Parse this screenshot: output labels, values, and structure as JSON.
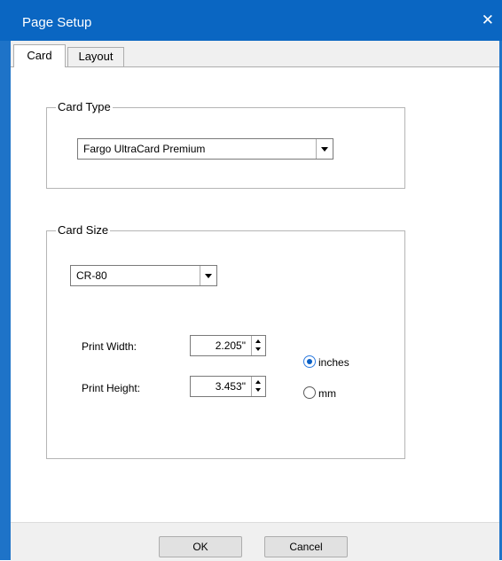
{
  "window": {
    "title": "Page Setup",
    "close_icon": "close-icon"
  },
  "tabs": [
    {
      "label": "Card",
      "selected": true
    },
    {
      "label": "Layout",
      "selected": false
    }
  ],
  "card_type": {
    "legend": "Card Type",
    "selected": "Fargo UltraCard Premium"
  },
  "card_size": {
    "legend": "Card Size",
    "selected": "CR-80",
    "print_width_label": "Print Width:",
    "print_width_value": "2.205\"",
    "print_height_label": "Print Height:",
    "print_height_value": "3.453\"",
    "units": [
      {
        "label": "inches",
        "checked": true
      },
      {
        "label": "mm",
        "checked": false
      }
    ]
  },
  "buttons": {
    "ok": "OK",
    "cancel": "Cancel"
  },
  "colors": {
    "titlebar": "#0a66c2",
    "radio_accent": "#0a5fc4"
  }
}
